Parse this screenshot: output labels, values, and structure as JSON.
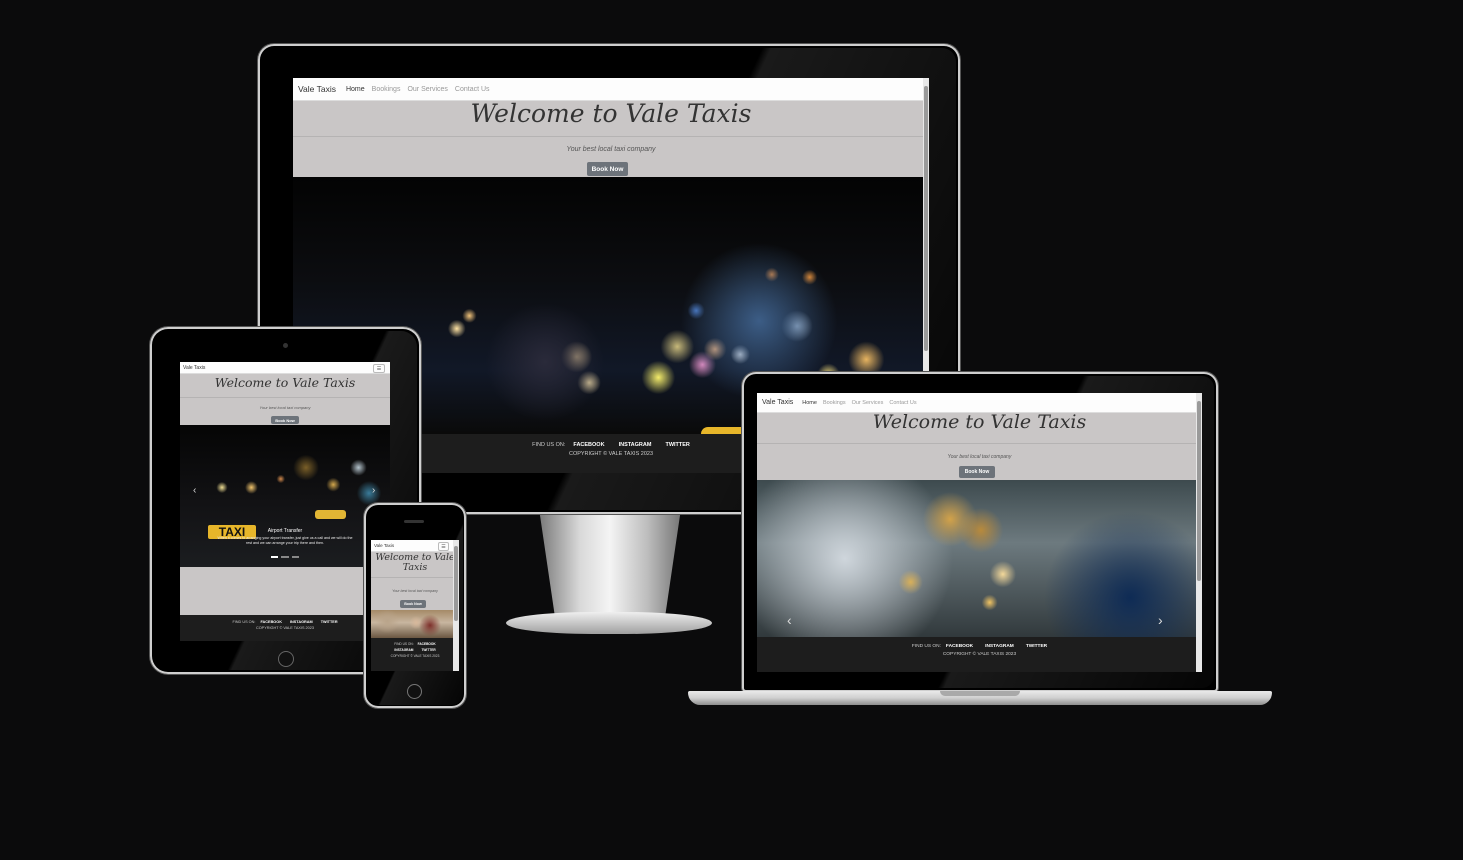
{
  "site": {
    "brand": "Vale Taxis",
    "nav": [
      "Home",
      "Bookings",
      "Our Services",
      "Contact Us"
    ],
    "title": "Welcome to Vale Taxis",
    "tagline": "Your best local taxi company",
    "button": "Book Now",
    "find_us": "FIND US ON:",
    "social": [
      "FACEBOOK",
      "INSTAGRAM",
      "TWITTER"
    ],
    "copyright": "COPYRIGHT © VALE TAXIS 2023"
  },
  "tablet": {
    "slide_caption_title": "Airport Transfer",
    "slide_caption_text": "When it comes to arranging your airport transfer, just give us a call and we will do the rest and we can arrange your trip there and then.",
    "taxi_sign": "TAXI"
  },
  "icons": {
    "menu": "☰",
    "prev": "‹",
    "next": "›"
  },
  "colors": {
    "hero_bg": "#c9c6c6",
    "footer_bg": "#1d1d1d",
    "button_bg": "#6d737a",
    "page_bg": "#0b0b0c"
  }
}
